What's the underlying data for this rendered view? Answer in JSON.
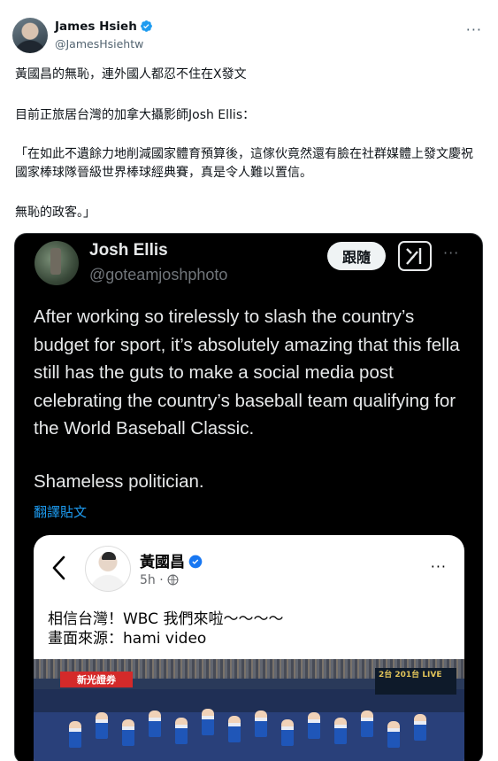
{
  "author": {
    "name": "James Hsieh",
    "handle": "@JamesHsiehtw",
    "more": "···"
  },
  "tweet": {
    "line1": "黃國昌的無恥，連外國人都忍不住在X發文",
    "line2": "目前正旅居台灣的加拿大攝影師Josh Ellis：",
    "line3": "「在如此不遺餘力地削減國家體育預算後，這傢伙竟然還有臉在社群媒體上發文慶祝國家棒球隊晉級世界棒球經典賽，真是令人難以置信。",
    "line4": "無恥的政客。」"
  },
  "embed": {
    "name": "Josh Ellis",
    "handle": "@goteamjoshphoto",
    "follow_label": "跟隨",
    "more": "···",
    "body": "After working so tirelessly to slash the country’s budget for sport, it’s absolutely amazing that this fella still has the guts to make a social media post celebrating the country’s baseball team qualifying for the World Baseball Classic.",
    "body2": "Shameless politician.",
    "translate_label": "翻譯貼文"
  },
  "card": {
    "name": "黃國昌",
    "meta": "5h ·",
    "more": "···",
    "text_line1": "相信台灣！WBC 我們來啦～～～～",
    "text_line2": "畫面來源：hami video",
    "photo": {
      "sponsor": "新光證券",
      "live_text": "2台 201台 LIVE"
    }
  },
  "colors": {
    "verified": "#1d9bf0",
    "fb_verified": "#1877f2",
    "dark_bg": "#000000",
    "link_blue": "#1d9bf0"
  }
}
